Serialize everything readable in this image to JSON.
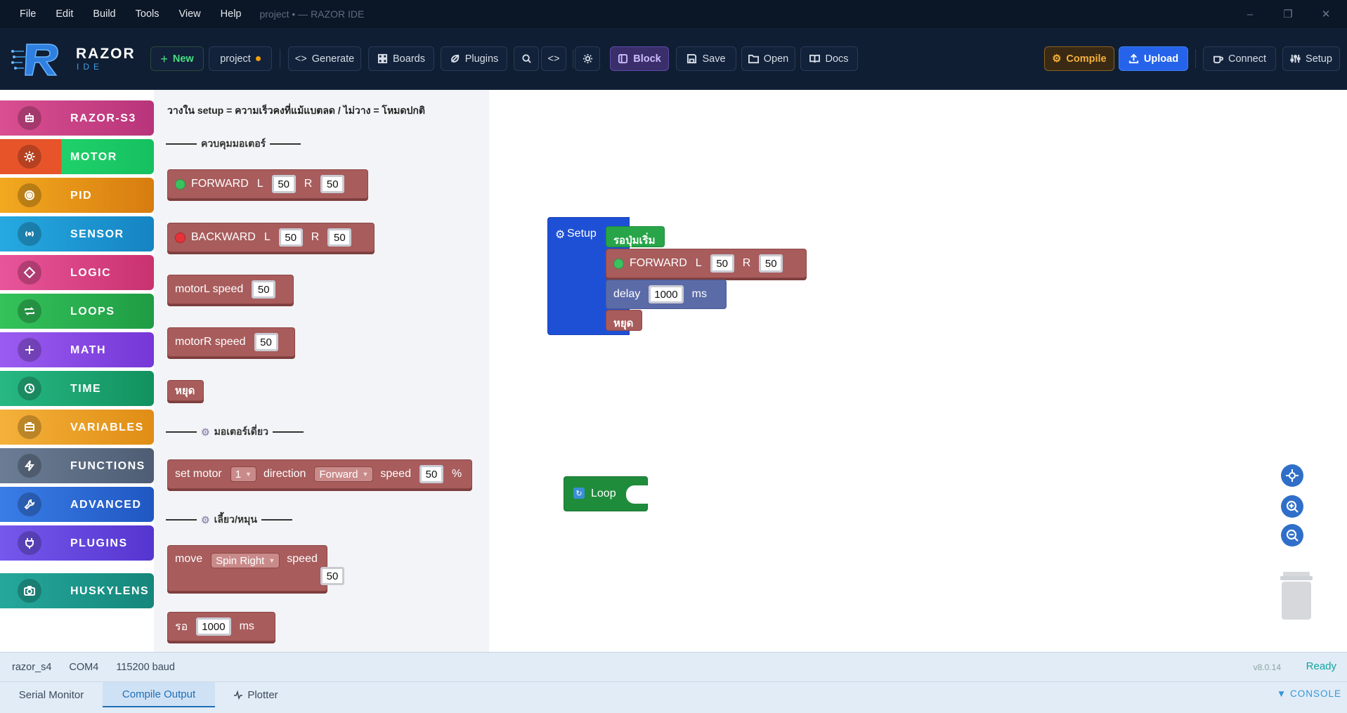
{
  "window": {
    "title": "project • — RAZOR IDE",
    "controls": [
      "–",
      "❐",
      "✕"
    ]
  },
  "menu": [
    "File",
    "Edit",
    "Build",
    "Tools",
    "View",
    "Help"
  ],
  "brand": {
    "name": "RAZOR",
    "sub": "IDE",
    "accent": "#3fa0e6"
  },
  "toolbar": {
    "new": "New",
    "project": "project",
    "generate": "Generate",
    "boards": "Boards",
    "plugins": "Plugins",
    "block": "Block",
    "save": "Save",
    "open": "Open",
    "docs": "Docs",
    "compile": "Compile",
    "upload": "Upload",
    "connect": "Connect",
    "setup": "Setup"
  },
  "categories": [
    {
      "label": "RAZOR-S3",
      "icon": "robot-icon",
      "color": "#d94f91"
    },
    {
      "label": "MOTOR",
      "icon": "gear-icon",
      "color": "#e8542a"
    },
    {
      "label": "PID",
      "icon": "target-icon",
      "color": "#e69a1f"
    },
    {
      "label": "SENSOR",
      "icon": "signal-icon",
      "color": "#1f9fd6"
    },
    {
      "label": "LOGIC",
      "icon": "diamond-icon",
      "color": "#e04b8c"
    },
    {
      "label": "LOOPS",
      "icon": "repeat-icon",
      "color": "#2bb24c"
    },
    {
      "label": "MATH",
      "icon": "plus-icon",
      "color": "#8b4ee0"
    },
    {
      "label": "TIME",
      "icon": "clock-icon",
      "color": "#1ea774"
    },
    {
      "label": "VARIABLES",
      "icon": "box-icon",
      "color": "#f0a325"
    },
    {
      "label": "FUNCTIONS",
      "icon": "bolt-icon",
      "color": "#5f7189"
    },
    {
      "label": "ADVANCED",
      "icon": "wrench-icon",
      "color": "#2f6fd6"
    },
    {
      "label": "PLUGINS",
      "icon": "plug-icon",
      "color": "#6a4fe0"
    },
    {
      "label": "HUSKYLENS",
      "icon": "camera-icon",
      "color": "#1f9e92"
    }
  ],
  "flyout": {
    "tip": "วางใน setup = ความเร็วคงที่แม้แบตลด / ไม่วาง = โหมดปกติ",
    "header_motor": "ควบคุมมอเตอร์",
    "forward": {
      "label": "FORWARD",
      "l": "L",
      "l_val": "50",
      "r": "R",
      "r_val": "50",
      "led": "#3cc060"
    },
    "backward": {
      "label": "BACKWARD",
      "l": "L",
      "l_val": "50",
      "r": "R",
      "r_val": "50",
      "led": "#e8323a"
    },
    "motorL": {
      "label": "motorL speed",
      "val": "50"
    },
    "motorR": {
      "label": "motorR speed",
      "val": "50"
    },
    "stop": "หยุด",
    "header_single": "มอเตอร์เดี่ยว",
    "set_motor": {
      "label": "set motor",
      "motor": "1",
      "direction": "direction",
      "dir_val": "Forward",
      "speed": "speed",
      "val": "50",
      "unit": "%"
    },
    "header_turn": "เลี้ยว/หมุน",
    "move": {
      "label": "move",
      "mode": "Spin Right",
      "speed": "speed",
      "val": "50"
    },
    "wait": {
      "label": "รอ",
      "val": "1000",
      "unit": "ms"
    }
  },
  "workspace": {
    "setup_label": "Setup",
    "wait_button": "รอปุ่มเริ่ม",
    "forward": {
      "label": "FORWARD",
      "l": "L",
      "l_val": "50",
      "r": "R",
      "r_val": "50"
    },
    "delay": {
      "label": "delay",
      "val": "1000",
      "unit": "ms"
    },
    "stop": "หยุด",
    "loop_label": "Loop"
  },
  "status": {
    "board": "razor_s4",
    "port": "COM4",
    "baud": "115200 baud",
    "version": "v8.0.14",
    "state": "Ready"
  },
  "console": {
    "tabs": [
      "Serial Monitor",
      "Compile Output",
      "Plotter"
    ],
    "active": "Compile Output",
    "toggle": "▼ CONSOLE"
  }
}
